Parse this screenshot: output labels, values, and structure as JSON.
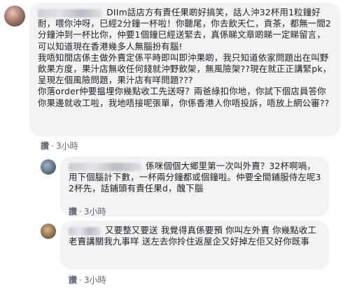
{
  "comments": [
    {
      "text": "DIIm話店方有責任果啲好搞笑，話人沖32杯用1粒鐘好耐，喂你沖呀，巳經2分鐘一杯啦！你聽尾，你去飲天仁，貢茶，都無一間2分鐘沖到一杯比你，仲要1個鐘巳經送緊去，真係睇文章啲睇一定睇留言，可以知道現在香港幾多人無腦扮有腦!\n我唔知間店係主做外賣定係平時即叫即沖果啲，我只知道依家問題出在叫野飲果方度，果汁店無收任何錢就沖野飲架，無風險架??現在就正正講緊pk，呈現左個風險問題，果汁店有咩問題???\n你落order仲要揾埋你幾點收工先送呀？兩爸綠扣你地，你試下個店員答你你果邊就收工啦，我地唔接呢張單，你係香港人你唔投訴，唔放上網公審??",
      "like_label": "讚",
      "time": "3小時"
    },
    {
      "text": "係咪個個大鄉里第一次叫外賣？32杯啊喎，用下個腦計下數，一杯兩分鐘都或個鐘啦。仲要全間鋪服侍左呢32杯先，話鋪頭有責任果d，醜下腦",
      "like_label": "讚",
      "time": "3小時"
    },
    {
      "text": "又要整又要送 我覺得真係要預 你叫左外賣 你幾點收工老賣講關我九事咩 送左去你拎住返屋企又好掉左佢又好你既事",
      "like_label": "讚",
      "time": "3小時"
    }
  ]
}
